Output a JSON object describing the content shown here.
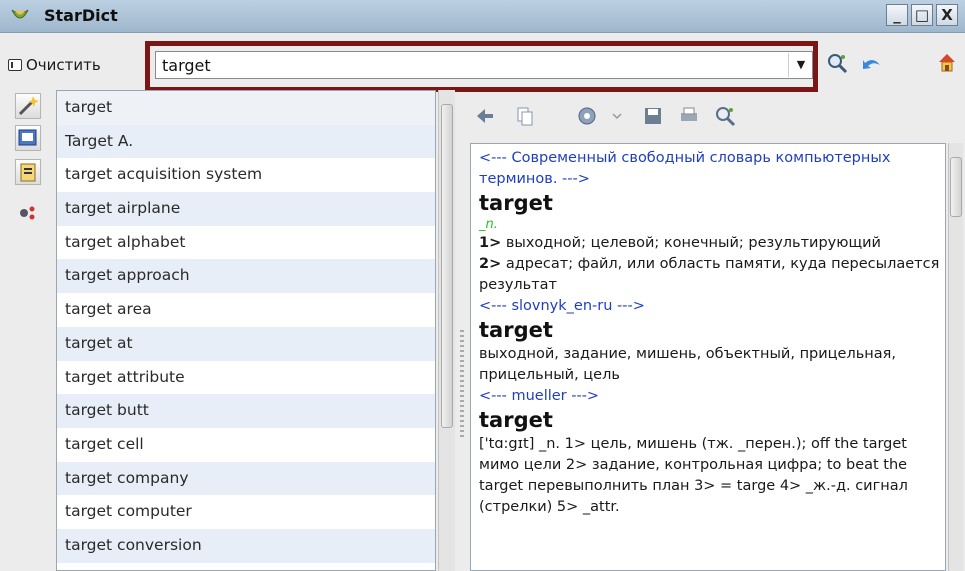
{
  "window": {
    "title": "StarDict",
    "minimize": "_",
    "maximize": "□",
    "close": "X"
  },
  "toolbar": {
    "clear_label": "Очистить",
    "search_value": "target",
    "dropdown_glyph": "▼"
  },
  "words": [
    "target",
    "Target A.",
    "target acquisition system",
    "target airplane",
    "target alphabet",
    "target approach",
    "target area",
    "target at",
    "target attribute",
    "target butt",
    "target cell",
    "target company",
    "target computer",
    "target conversion"
  ],
  "definition": {
    "src1": "<--- Современный свободный словарь компьютерных терминов. --->",
    "head1": "target",
    "pos1": "_n.",
    "line1_num": "1>",
    "line1": " выходной; целевой; конечный; результирующий",
    "line2_num": "2>",
    "line2": " адресат; файл, или область памяти, куда пересылается результат",
    "src2": "<--- slovnyk_en-ru --->",
    "head2": "target",
    "text2": "выходной, задание, мишень, объектный, прицельная, прицельный, цель",
    "src3": "<--- mueller --->",
    "head3": "target",
    "text3": "['tɑ:gɪt] _n. 1> цель, мишень (тж. _перен.); off the target мимо цели 2> задание, контрольная цифра; to beat the target перевыполнить план 3> = targe 4> _ж.-д. сигнал (стрелки) 5> _attr."
  }
}
